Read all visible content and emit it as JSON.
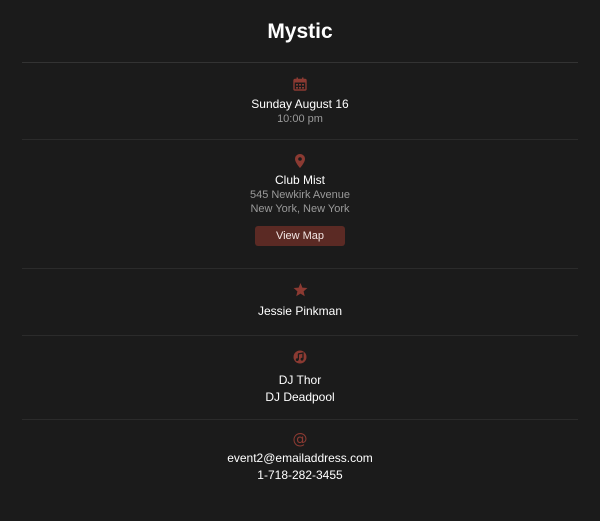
{
  "event": {
    "title": "Mystic"
  },
  "date_section": {
    "icon": "calendar-icon",
    "date": "Sunday August 16",
    "time": "10:00 pm"
  },
  "venue_section": {
    "icon": "map-pin-icon",
    "name": "Club Mist",
    "address_line1": "545 Newkirk Avenue",
    "address_line2": "New York, New York",
    "map_button_label": "View Map"
  },
  "host_section": {
    "icon": "star-icon",
    "name": "Jessie Pinkman"
  },
  "djs_section": {
    "icon": "music-icon",
    "djs": [
      "DJ Thor",
      "DJ Deadpool"
    ]
  },
  "contact_section": {
    "icon": "at-icon",
    "at_symbol": "@",
    "email": "event2@emailaddress.com",
    "phone": "1-718-282-3455"
  },
  "colors": {
    "background": "#1b1b1b",
    "accent": "#8b3a32",
    "button": "#5b2a24",
    "muted_text": "#9a9a9a"
  }
}
